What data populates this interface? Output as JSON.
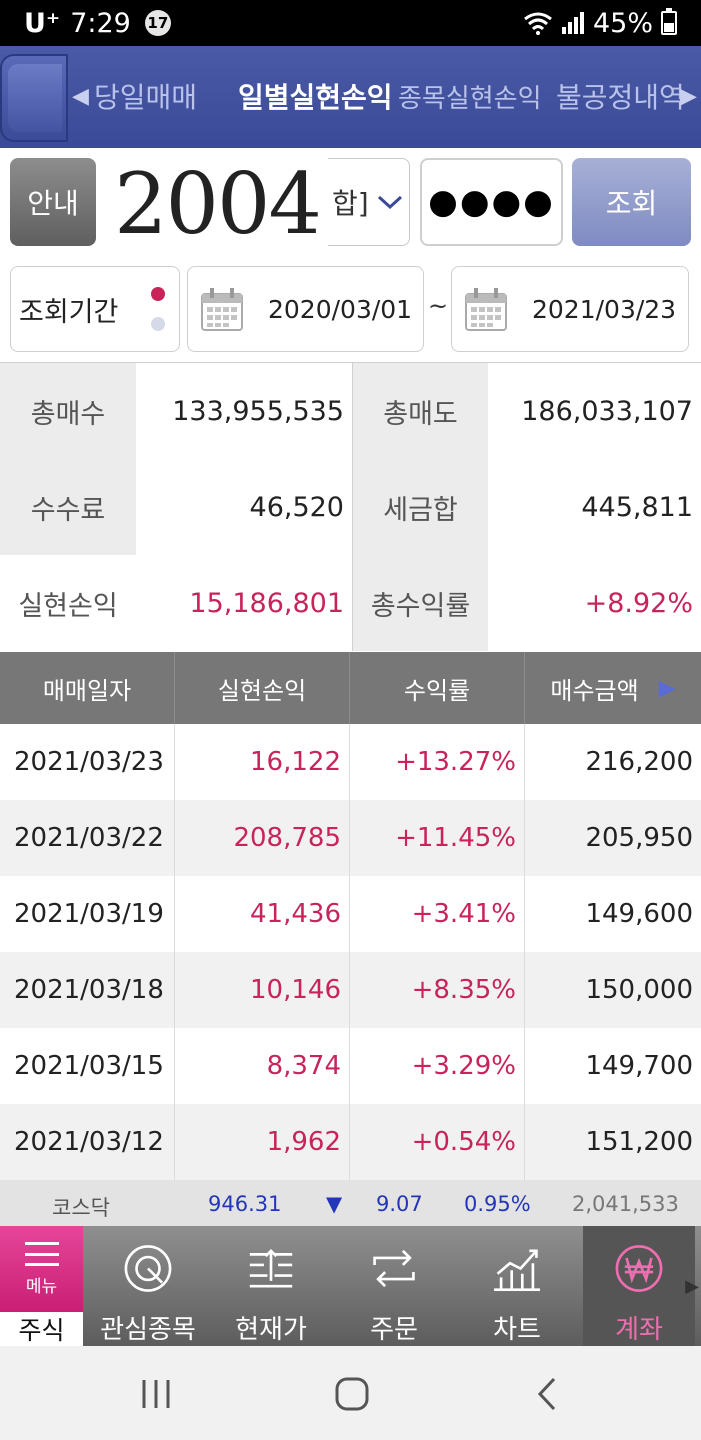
{
  "status_bar": {
    "carrier": "U⁺",
    "time": "7:29",
    "notification_count": "17",
    "battery": "45%"
  },
  "tabs": [
    {
      "label": "당일매매",
      "active": false
    },
    {
      "label": "일별실현손익",
      "active": true
    },
    {
      "label": "종목실현손익",
      "active": false
    },
    {
      "label": "불공정내역",
      "active": false
    }
  ],
  "query": {
    "guide_label": "안내",
    "account_logo": "2004",
    "account_suffix": "합]",
    "password_mask": "●●●●",
    "query_label": "조회"
  },
  "period": {
    "label": "조회기간",
    "start_date": "2020/03/01",
    "separator": "~",
    "end_date": "2021/03/23"
  },
  "summary": {
    "total_buy_label": "총매수",
    "total_buy": "133,955,535",
    "total_sell_label": "총매도",
    "total_sell": "186,033,107",
    "fee_label": "수수료",
    "fee": "46,520",
    "tax_label": "세금합",
    "tax": "445,811",
    "realized_label": "실현손익",
    "realized": "15,186,801",
    "return_label": "총수익률",
    "return_rate": "+8.92%"
  },
  "table": {
    "headers": [
      "매매일자",
      "실현손익",
      "수익률",
      "매수금액"
    ],
    "rows": [
      {
        "date": "2021/03/23",
        "profit": "16,122",
        "rate": "+13.27%",
        "buy": "216,200"
      },
      {
        "date": "2021/03/22",
        "profit": "208,785",
        "rate": "+11.45%",
        "buy": "205,950"
      },
      {
        "date": "2021/03/19",
        "profit": "41,436",
        "rate": "+3.41%",
        "buy": "149,600"
      },
      {
        "date": "2021/03/18",
        "profit": "10,146",
        "rate": "+8.35%",
        "buy": "150,000"
      },
      {
        "date": "2021/03/15",
        "profit": "8,374",
        "rate": "+3.29%",
        "buy": "149,700"
      },
      {
        "date": "2021/03/12",
        "profit": "1,962",
        "rate": "+0.54%",
        "buy": "151,200"
      }
    ]
  },
  "ticker": {
    "index_name": "코스닥",
    "index_value": "946.31",
    "direction": "▼",
    "change": "9.07",
    "change_pct": "0.95%",
    "volume": "2,041,533"
  },
  "bottom_nav": {
    "menu_label": "메뉴",
    "stock_label": "주식",
    "items": [
      {
        "label": "관심종목",
        "icon": "target-icon"
      },
      {
        "label": "현재가",
        "icon": "price-icon"
      },
      {
        "label": "주문",
        "icon": "exchange-icon"
      },
      {
        "label": "차트",
        "icon": "chart-icon"
      },
      {
        "label": "계좌",
        "icon": "won-icon"
      }
    ]
  },
  "colors": {
    "accent": "#3a4a98",
    "positive": "#c8245a",
    "menu_pink": "#d92c85"
  }
}
